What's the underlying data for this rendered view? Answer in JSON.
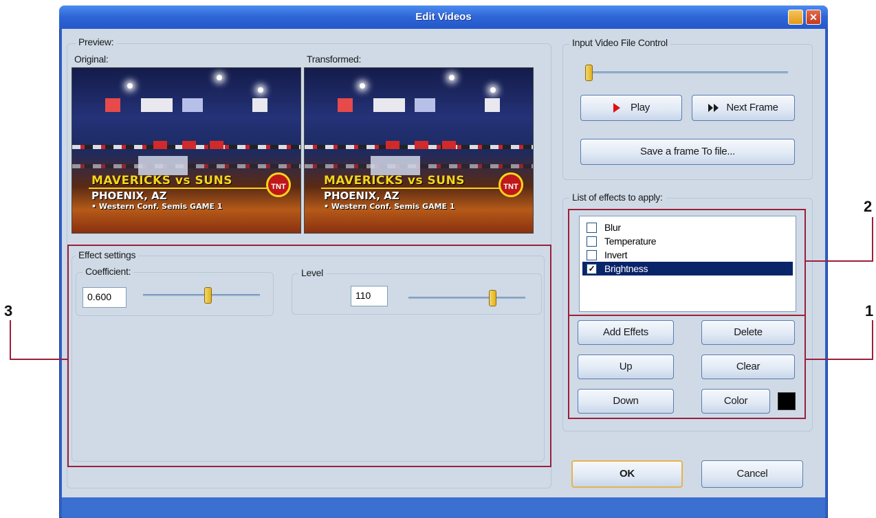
{
  "window": {
    "title": "Edit Videos",
    "close_glyph": "✕"
  },
  "preview": {
    "group_label": "Preview:",
    "original_label": "Original:",
    "transformed_label": "Transformed:",
    "frame_text": {
      "line1": "MAVERICKS vs SUNS",
      "line2": "PHOENIX, AZ",
      "line3": "• Western Conf. Semis GAME 1",
      "logo": "TNT"
    }
  },
  "effect_settings": {
    "group_label": "Effect settings",
    "coefficient": {
      "label": "Coefficient:",
      "value": "0.600",
      "slider_fraction": 0.55
    },
    "level": {
      "label": "Level",
      "value": "110",
      "slider_fraction": 0.72
    }
  },
  "input_control": {
    "group_label": "Input Video File Control",
    "position_fraction": 0.0,
    "play_label": "Play",
    "next_frame_label": "Next Frame",
    "save_frame_label": "Save a frame To file..."
  },
  "effects_list": {
    "group_label": "List of effects to apply:",
    "items": [
      {
        "label": "Blur",
        "checked": false,
        "selected": false
      },
      {
        "label": "Temperature",
        "checked": false,
        "selected": false
      },
      {
        "label": "Invert",
        "checked": false,
        "selected": false
      },
      {
        "label": "Brightness",
        "checked": true,
        "selected": true
      }
    ]
  },
  "effect_buttons": {
    "add": "Add Effets",
    "delete": "Delete",
    "up": "Up",
    "clear": "Clear",
    "down": "Down",
    "color": "Color",
    "color_swatch": "#000000"
  },
  "dialog_buttons": {
    "ok": "OK",
    "cancel": "Cancel"
  },
  "annotations": {
    "label_1": "1",
    "label_2": "2",
    "label_3": "3",
    "highlight_color": "#9b1f3a"
  },
  "icons": {
    "play": "red-triangle-play-icon",
    "next_frame": "double-triangle-icon",
    "check": "✓"
  }
}
